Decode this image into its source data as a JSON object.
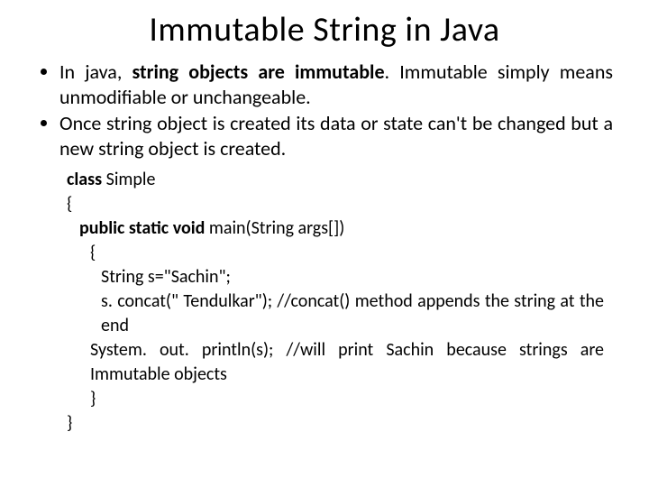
{
  "title": "Immutable String in Java",
  "bullets": [
    {
      "pre": "In java, ",
      "bold": "string objects are immutable",
      "post": ". Immutable simply means unmodifiable or unchangeable."
    },
    {
      "pre": "",
      "bold": "",
      "post": "Once string object is created its data or state can't be changed but a new string object is created."
    }
  ],
  "code": {
    "l1a": "class",
    "l1b": " Simple",
    "l2": "{",
    "l3a": "public static void",
    "l3b": " main(String args[])",
    "l4": "{",
    "l5": "String s=\"Sachin\";",
    "l6": "s. concat(\" Tendulkar\"); //concat() method appends the string            at the end",
    "l7": "System. out. println(s); //will print Sachin because strings are Immutable objects",
    "l8": "}",
    "l9": "}"
  }
}
